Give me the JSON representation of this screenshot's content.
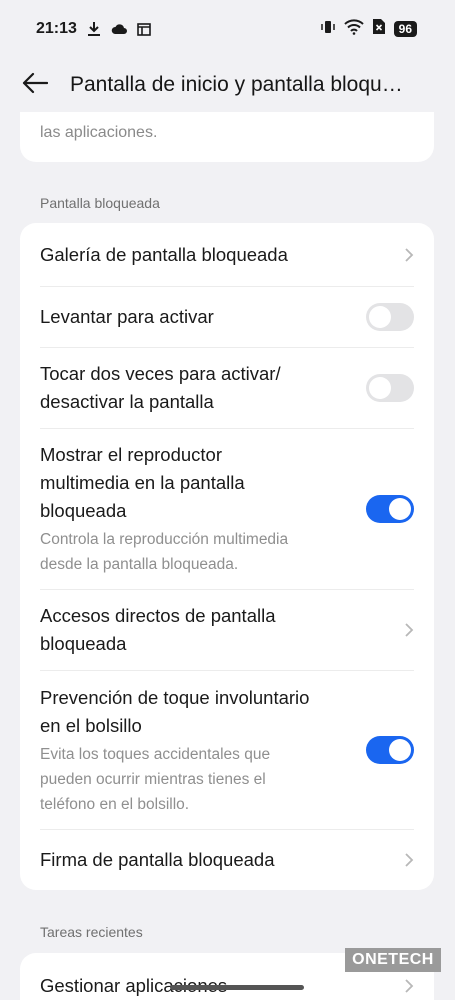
{
  "status_bar": {
    "time": "21:13",
    "battery": "96"
  },
  "header": {
    "title": "Pantalla de inicio y pantalla bloqu…"
  },
  "top_card": {
    "text": "las aplicaciones."
  },
  "section_lock": {
    "label": "Pantalla bloqueada",
    "rows": [
      {
        "title": "Galería de pantalla bloqueada",
        "type": "nav"
      },
      {
        "title": "Levantar para activar",
        "type": "toggle",
        "on": false
      },
      {
        "title_l1": "Tocar dos veces para activar/",
        "title_l2": "desactivar la pantalla",
        "type": "toggle",
        "on": false
      },
      {
        "title_l1": "Mostrar el reproductor",
        "title_l2": "multimedia en la pantalla",
        "title_l3": "bloqueada",
        "sub_l1": "Controla la reproducción multimedia",
        "sub_l2": "desde la pantalla bloqueada.",
        "type": "toggle",
        "on": true
      },
      {
        "title_l1": "Accesos directos de pantalla",
        "title_l2": "bloqueada",
        "type": "nav"
      },
      {
        "title_l1": "Prevención de toque involuntario",
        "title_l2": "en el bolsillo",
        "sub_l1": "Evita los toques accidentales que",
        "sub_l2": "pueden ocurrir mientras tienes el",
        "sub_l3": "teléfono en el bolsillo.",
        "type": "toggle",
        "on": true
      },
      {
        "title": "Firma de pantalla bloqueada",
        "type": "nav"
      }
    ]
  },
  "section_recent": {
    "label": "Tareas recientes",
    "rows": [
      {
        "title": "Gestionar aplicaciones",
        "type": "nav"
      }
    ]
  },
  "watermark": "ONETECH",
  "colors": {
    "accent": "#1a66f0",
    "background": "#f1f1f4",
    "card": "#ffffff"
  },
  "icons": [
    "download-icon",
    "cloud-icon",
    "window-icon",
    "vibrate-icon",
    "wifi-icon",
    "sim-off-icon",
    "back-arrow-icon",
    "chevron-right-icon"
  ]
}
